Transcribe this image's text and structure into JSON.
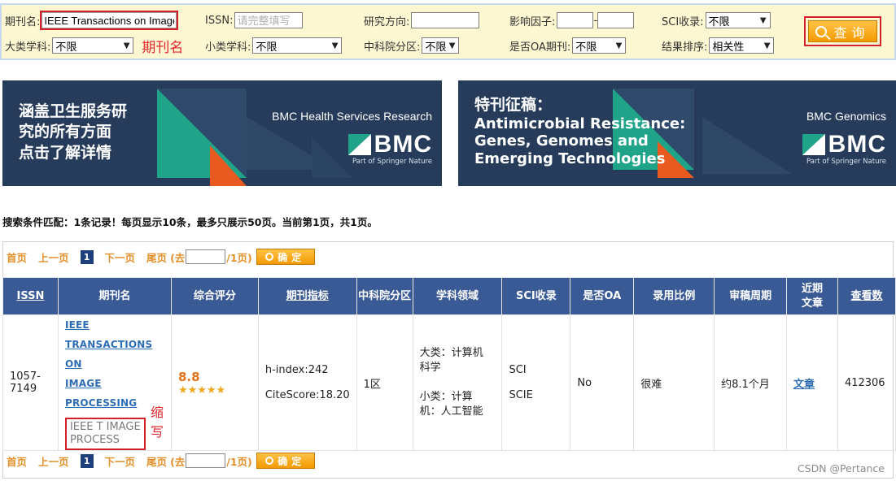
{
  "search": {
    "journal_label": "期刊名:",
    "journal_value": "IEEE Transactions on Image",
    "issn_label": "ISSN:",
    "issn_placeholder": "请完整填写",
    "research_label": "研究方向:",
    "impact_label": "影响因子:",
    "impact_sep": "-",
    "sci_label": "SCI收录:",
    "sci_value": "不限",
    "big_cat_label": "大类学科:",
    "big_cat_value": "不限",
    "annotation_journal": "期刊名",
    "small_cat_label": "小类学科:",
    "small_cat_value": "不限",
    "cas_label": "中科院分区:",
    "cas_value": "不限",
    "oa_label": "是否OA期刊:",
    "oa_value": "不限",
    "sort_label": "结果排序:",
    "sort_value": "相关性",
    "button_label": "查询"
  },
  "banners": [
    {
      "headline": [
        "涵盖卫生服务研",
        "究的所有方面",
        "点击了解详情"
      ],
      "brand_title": "BMC Health Services Research",
      "logo": "BMC",
      "springer": "Part of Springer Nature"
    },
    {
      "headline": [
        "特刊征稿：",
        "Antimicrobial Resistance:",
        "Genes, Genomes and",
        "Emerging Technologies"
      ],
      "brand_title": "BMC Genomics",
      "logo": "BMC",
      "springer": "Part of Springer Nature"
    }
  ],
  "summary": "搜索条件匹配：1条记录！每页显示10条，最多只展示50页。当前第1页，共1页。",
  "pager": {
    "first": "首页",
    "prev": "上一页",
    "current": "1",
    "next": "下一页",
    "last": "尾页",
    "goto_prefix": "(去",
    "goto_suffix": "/1页)",
    "confirm": "确定"
  },
  "table": {
    "headers": {
      "issn": "ISSN",
      "name": "期刊名",
      "score": "综合评分",
      "metrics": "期刊指标",
      "cas": "中科院分区",
      "field": "学科领域",
      "sci": "SCI收录",
      "oa": "是否OA",
      "ratio": "录用比例",
      "review": "审稿周期",
      "recent_1": "近期",
      "recent_2": "文章",
      "views": "查看数"
    },
    "row": {
      "issn_1": "1057-",
      "issn_2": "7149",
      "title_lines": [
        "IEEE",
        "TRANSACTIONS ON",
        "IMAGE",
        "PROCESSING"
      ],
      "abbr_1": "IEEE T IMAGE",
      "abbr_2": "PROCESS",
      "abbr_note": "缩写",
      "score": "8.8",
      "stars": "★★★★★",
      "h_index": "h-index:242",
      "citescore": "CiteScore:18.20",
      "cas": "1区",
      "big_cat_1": "大类：计算机",
      "big_cat_2": "科学",
      "small_cat_1": "小类：计算",
      "small_cat_2": "机：人工智能",
      "sci_1": "SCI",
      "sci_2": "SCIE",
      "oa": "No",
      "ratio": "很难",
      "review": "约8.1个月",
      "recent": "文章",
      "views": "412306"
    }
  },
  "watermark": "CSDN @Pertance",
  "colors": {
    "accent": "#3a5a95",
    "orange": "#f5a000",
    "banner": "#263c5a",
    "annotation_red": "#d4202a"
  }
}
